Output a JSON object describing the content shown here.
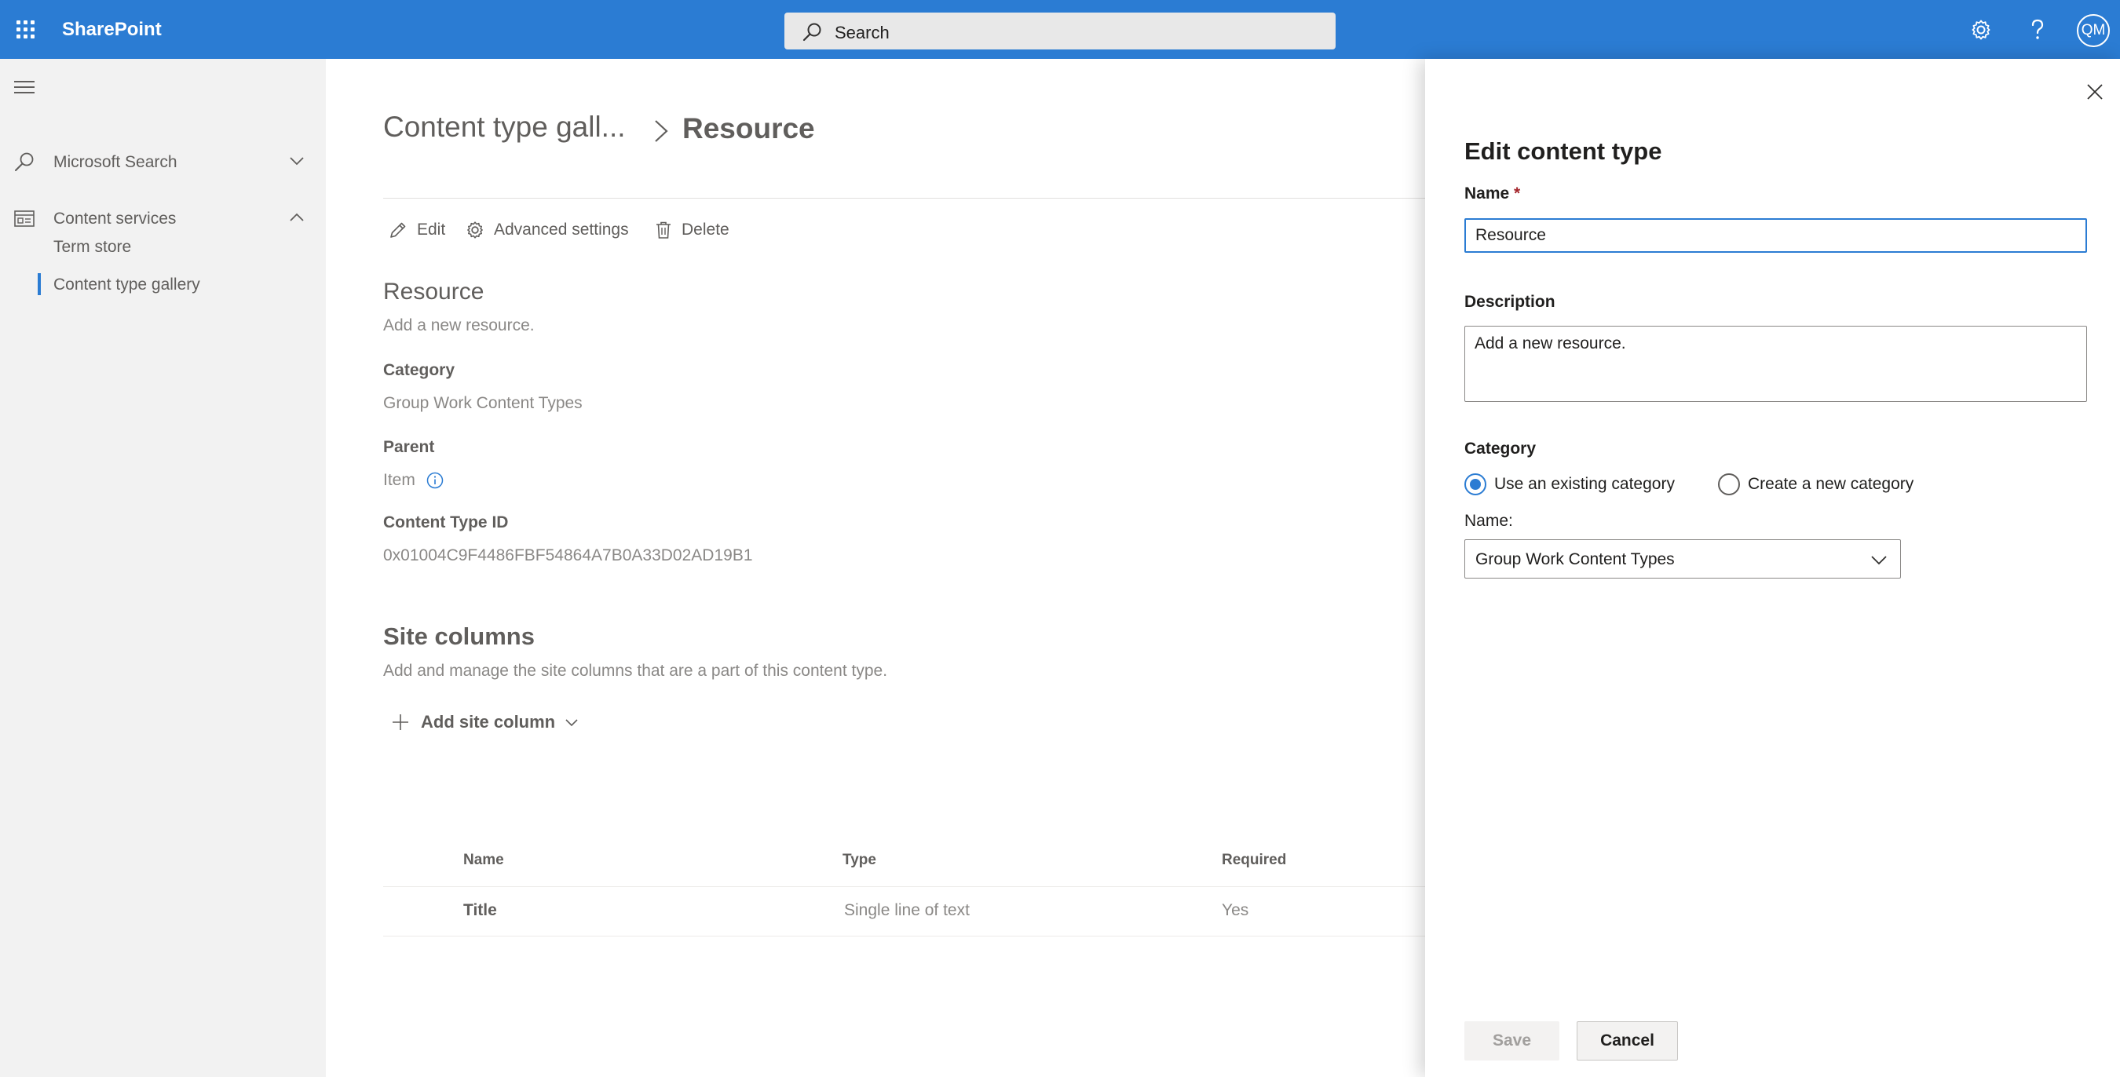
{
  "suite_bar": {
    "brand": "SharePoint",
    "search_placeholder": "Search",
    "user_initials": "QM"
  },
  "left_nav": {
    "items": [
      {
        "label": "Microsoft Search",
        "expanded": false
      },
      {
        "label": "Content services",
        "expanded": true
      }
    ],
    "sub_items": [
      {
        "label": "Term store",
        "selected": false
      },
      {
        "label": "Content type gallery",
        "selected": true
      }
    ]
  },
  "main": {
    "breadcrumb": {
      "parent": "Content type gall...",
      "current": "Resource"
    },
    "commands": {
      "edit": "Edit",
      "advanced_settings": "Advanced settings",
      "delete": "Delete"
    },
    "content_type": {
      "name": "Resource",
      "description": "Add a new resource.",
      "category_label": "Category",
      "category_value": "Group Work Content Types",
      "parent_label": "Parent",
      "parent_value": "Item",
      "id_label": "Content Type ID",
      "id_value": "0x01004C9F4486FBF54864A7B0A33D02AD19B1"
    },
    "site_columns": {
      "heading": "Site columns",
      "description": "Add and manage the site columns that are a part of this content type.",
      "add_button": "Add site column",
      "headers": [
        "Name",
        "Type",
        "Required"
      ],
      "rows": [
        {
          "name": "Title",
          "type": "Single line of text",
          "required": "Yes"
        }
      ]
    }
  },
  "panel": {
    "title": "Edit content type",
    "name_label": "Name",
    "required_mark": "*",
    "name_value": "Resource",
    "description_label": "Description",
    "description_value": "Add a new resource.",
    "category_label": "Category",
    "radio_existing": "Use an existing category",
    "radio_new": "Create a new category",
    "selected_radio": "existing",
    "dropdown_label": "Name:",
    "dropdown_value": "Group Work Content Types",
    "save_label": "Save",
    "cancel_label": "Cancel"
  },
  "colors": {
    "suite_bar": "#2b7cd3",
    "accent": "#2b7cd3",
    "nav_background": "#f2f2f2",
    "required": "#a4262c"
  }
}
